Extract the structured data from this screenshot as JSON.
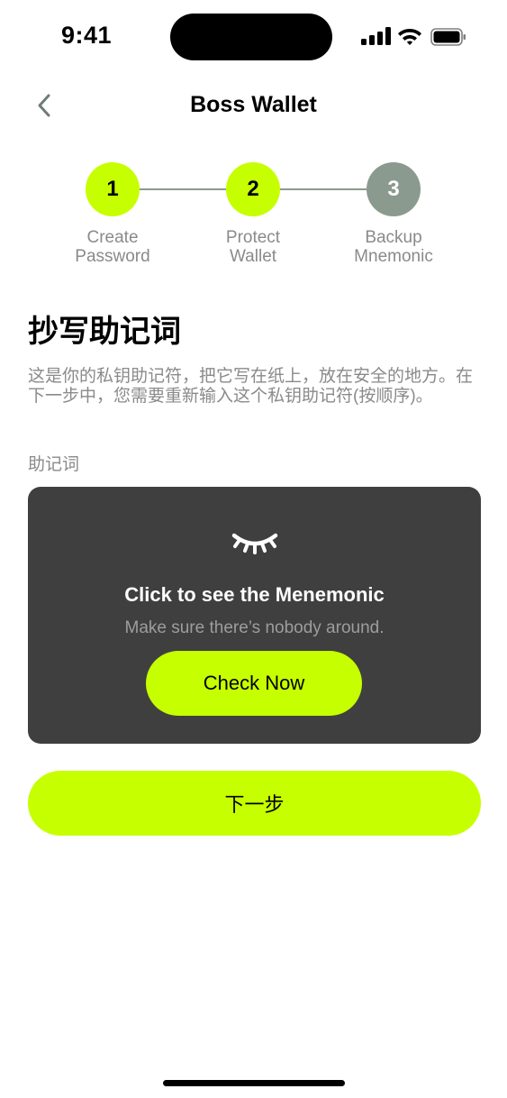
{
  "status_bar": {
    "time": "9:41"
  },
  "nav": {
    "title": "Boss Wallet"
  },
  "stepper": {
    "steps": [
      {
        "number": "1",
        "label_line1": "Create",
        "label_line2": "Password",
        "state": "completed"
      },
      {
        "number": "2",
        "label_line1": "Protect",
        "label_line2": "Wallet",
        "state": "completed"
      },
      {
        "number": "3",
        "label_line1": "Backup",
        "label_line2": "Mnemonic",
        "state": "current"
      }
    ],
    "colors": {
      "active": "#c6ff00",
      "inactive": "#8b9a8f"
    }
  },
  "content": {
    "heading": "抄写助记词",
    "description": "这是你的私钥助记符，把它写在纸上，放在安全的地方。在下一步中，您需要重新输入这个私钥助记符(按顺序)。",
    "section_label": "助记词"
  },
  "mnemonic_card": {
    "icon": "eye-closed-icon",
    "title": "Click to see the Menemonic",
    "subtitle": "Make sure there’s nobody around.",
    "button_label": "Check Now"
  },
  "footer": {
    "next_label": "下一步"
  },
  "colors": {
    "accent": "#c6ff00",
    "card_bg": "#3f3f3f",
    "muted_text": "#8a8a8a"
  }
}
